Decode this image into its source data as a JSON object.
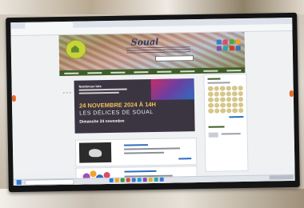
{
  "site": {
    "title": "Soual",
    "menu_items": [
      "",
      "",
      "",
      "",
      "",
      "",
      "",
      ""
    ],
    "search_placeholder": ""
  },
  "promo": {
    "line1": "Nombreux lots",
    "date": "24 NOVEMBRE 2024 À 14H",
    "brand": "LES DÉLICES DE SOUAL",
    "day": "Dimanche 24 novembre"
  },
  "colors": {
    "menu_bar": "#3f5d2a",
    "accent_orange": "#e4692c",
    "promo_bg": "#3b3542",
    "title_color": "#2c3d63"
  },
  "icons": [
    "logo-icon",
    "search-icon",
    "arrow-left-icon",
    "arrow-right-icon",
    "windows-start-icon"
  ]
}
